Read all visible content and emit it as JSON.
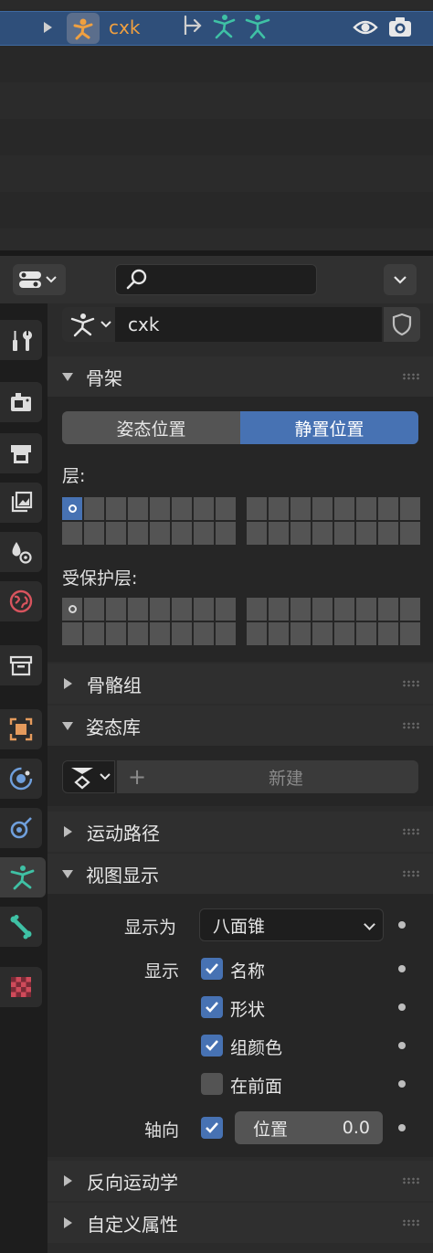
{
  "outliner": {
    "object_name": "cxk"
  },
  "header": {
    "search_placeholder": ""
  },
  "datablock": {
    "name": "cxk"
  },
  "skeleton": {
    "title": "骨架",
    "pose_position": "姿态位置",
    "rest_position": "静置位置",
    "active_position": "rest_position",
    "layers_label": "层:",
    "protected_layers_label": "受保护层:"
  },
  "bone_groups": {
    "title": "骨骼组"
  },
  "pose_library": {
    "title": "姿态库",
    "new_label": "新建"
  },
  "motion_paths": {
    "title": "运动路径"
  },
  "viewport_display": {
    "title": "视图显示",
    "display_as_label": "显示为",
    "display_as_value": "八面锥",
    "show_label": "显示",
    "options": [
      {
        "label": "名称",
        "checked": true
      },
      {
        "label": "形状",
        "checked": true
      },
      {
        "label": "组颜色",
        "checked": true
      },
      {
        "label": "在前面",
        "checked": false
      }
    ],
    "axes_label": "轴向",
    "axes_checked": true,
    "position_label": "位置",
    "position_value": "0.0"
  },
  "inverse_kinematics": {
    "title": "反向运动学"
  },
  "custom_properties": {
    "title": "自定义属性"
  },
  "colors": {
    "accent": "#4772b3",
    "selected_row": "#2f4f7a",
    "object_name": "#f0a040",
    "armature_teal": "#3fc1a5"
  }
}
